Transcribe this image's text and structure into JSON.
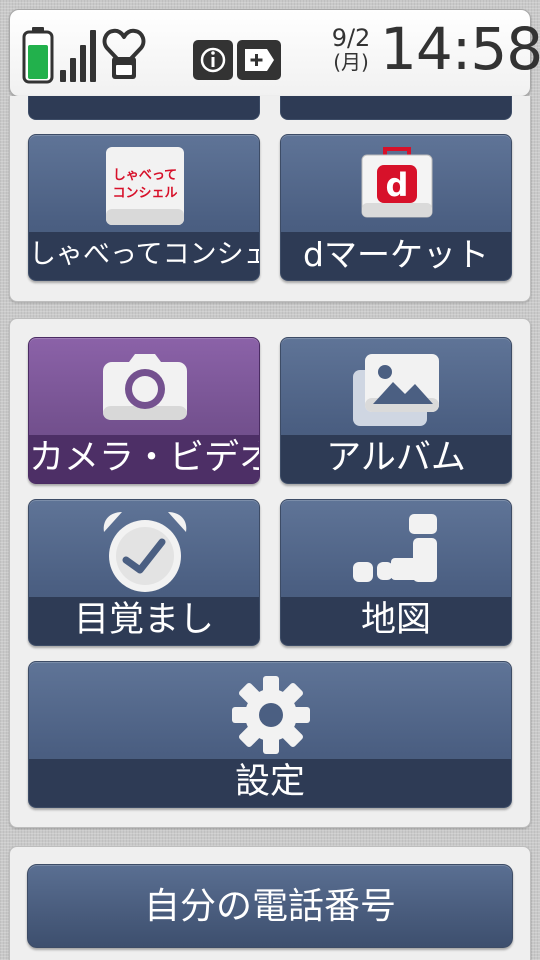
{
  "status_bar": {
    "date_top": "9/2",
    "date_bottom": "(月)",
    "time": "14:58",
    "icons": [
      "battery-icon",
      "signal-icon",
      "heart-charm-icon",
      "info-icon",
      "add-box-icon"
    ],
    "battery_color": "#22b14c"
  },
  "tiles": {
    "shabette_concier": {
      "label": "しゃべってコンシェル",
      "icon_text_top": "しゃべって",
      "icon_text_bottom": "コンシェル"
    },
    "d_market": {
      "label": "dマーケット",
      "icon_letter": "d"
    },
    "camera_video": {
      "label": "カメラ・ビデオ"
    },
    "album": {
      "label": "アルバム"
    },
    "alarm": {
      "label": "目覚まし"
    },
    "map": {
      "label": "地図"
    },
    "settings": {
      "label": "設定"
    }
  },
  "footer": {
    "my_number_label": "自分の電話番号"
  },
  "colors": {
    "tile_blue": "#4b5f82",
    "tile_purple": "#74518f",
    "label_band": "#2e3b55",
    "docomo_red": "#d7112a"
  }
}
